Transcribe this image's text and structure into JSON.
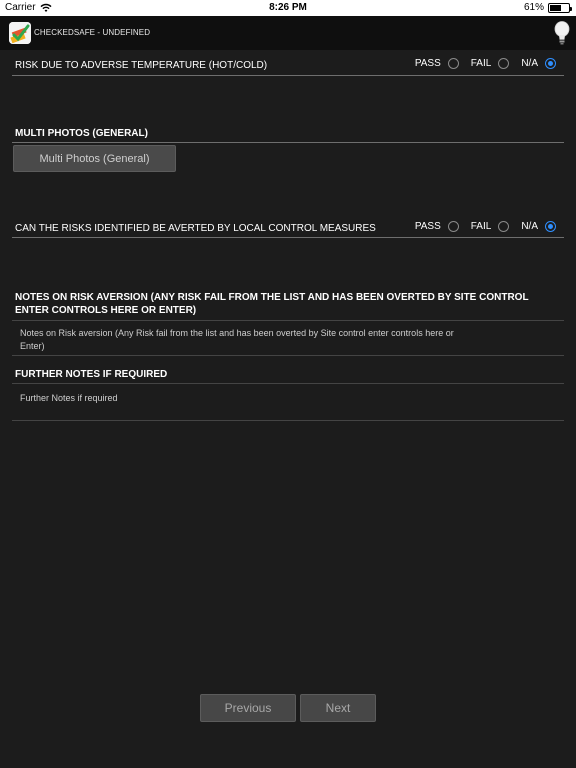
{
  "status_bar": {
    "carrier": "Carrier",
    "time": "8:26 PM",
    "battery": "61%",
    "battery_level": 0.61
  },
  "app": {
    "title": "CHECKEDSAFE - UNDEFINED",
    "logo_icon": "checkedsafe-logo",
    "hint_icon": "lightbulb-icon"
  },
  "form": {
    "q1": {
      "label": "RISK DUE TO ADVERSE TEMPERATURE (HOT/COLD)",
      "options": [
        "PASS",
        "FAIL",
        "N/A"
      ],
      "selected": "N/A"
    },
    "photos": {
      "label": "MULTI PHOTOS (GENERAL)",
      "button": "Multi Photos (General)"
    },
    "q2": {
      "label": "CAN THE RISKS IDENTIFIED BE AVERTED BY LOCAL CONTROL MEASURES",
      "options": [
        "PASS",
        "FAIL",
        "N/A"
      ],
      "selected": "N/A"
    },
    "notes": {
      "label_line1": "NOTES ON RISK AVERSION (ANY RISK FAIL FROM THE LIST AND HAS BEEN OVERTED BY SITE CONTROL",
      "label_line2": "ENTER CONTROLS HERE OR ENTER)",
      "placeholder_line1": "Notes on Risk aversion (Any Risk fail from the list and has been overted by Site control enter controls here or",
      "placeholder_line2": "Enter)"
    },
    "further": {
      "label": "FURTHER NOTES IF REQUIRED",
      "placeholder": "Further Notes if required"
    }
  },
  "nav": {
    "previous": "Previous",
    "next": "Next"
  },
  "colors": {
    "background": "#1c1c1c",
    "header": "#0f0f0f",
    "radio_selected": "#2f8fff",
    "button": "#4a4a4a"
  }
}
